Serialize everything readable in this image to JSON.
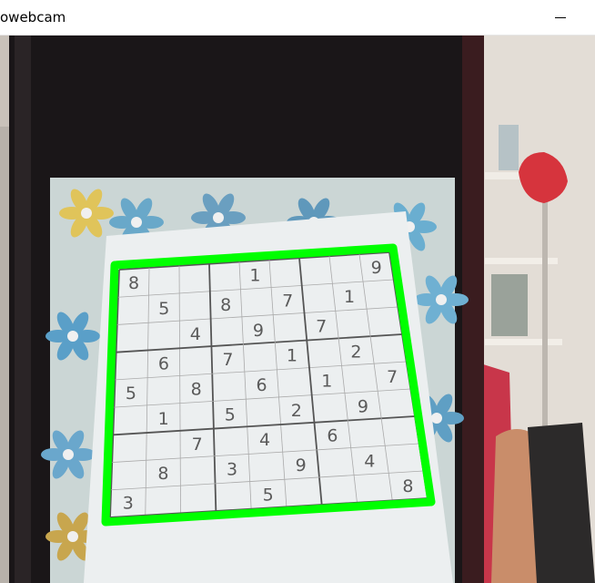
{
  "window": {
    "title": "owebcam",
    "minimize_icon": "minimize-icon"
  },
  "overlay": {
    "detection_color": "#00ff00"
  },
  "sudoku": {
    "digits": [
      {
        "v": "8",
        "r": 0,
        "c": 0
      },
      {
        "v": "1",
        "r": 0,
        "c": 4
      },
      {
        "v": "9",
        "r": 0,
        "c": 8
      },
      {
        "v": "5",
        "r": 1,
        "c": 1
      },
      {
        "v": "8",
        "r": 1,
        "c": 3
      },
      {
        "v": "7",
        "r": 1,
        "c": 5
      },
      {
        "v": "1",
        "r": 1,
        "c": 7
      },
      {
        "v": "4",
        "r": 2,
        "c": 2
      },
      {
        "v": "9",
        "r": 2,
        "c": 4
      },
      {
        "v": "7",
        "r": 2,
        "c": 6
      },
      {
        "v": "6",
        "r": 3,
        "c": 1
      },
      {
        "v": "7",
        "r": 3,
        "c": 3
      },
      {
        "v": "1",
        "r": 3,
        "c": 5
      },
      {
        "v": "2",
        "r": 3,
        "c": 7
      },
      {
        "v": "5",
        "r": 4,
        "c": 0
      },
      {
        "v": "8",
        "r": 4,
        "c": 2
      },
      {
        "v": "6",
        "r": 4,
        "c": 4
      },
      {
        "v": "1",
        "r": 4,
        "c": 6
      },
      {
        "v": "7",
        "r": 4,
        "c": 8
      },
      {
        "v": "1",
        "r": 5,
        "c": 1
      },
      {
        "v": "5",
        "r": 5,
        "c": 3
      },
      {
        "v": "2",
        "r": 5,
        "c": 5
      },
      {
        "v": "9",
        "r": 5,
        "c": 7
      },
      {
        "v": "7",
        "r": 6,
        "c": 2
      },
      {
        "v": "4",
        "r": 6,
        "c": 4
      },
      {
        "v": "6",
        "r": 6,
        "c": 6
      },
      {
        "v": "8",
        "r": 7,
        "c": 1
      },
      {
        "v": "3",
        "r": 7,
        "c": 3
      },
      {
        "v": "9",
        "r": 7,
        "c": 5
      },
      {
        "v": "4",
        "r": 7,
        "c": 7
      },
      {
        "v": "3",
        "r": 8,
        "c": 0
      },
      {
        "v": "5",
        "r": 8,
        "c": 4
      },
      {
        "v": "8",
        "r": 8,
        "c": 8
      }
    ]
  }
}
